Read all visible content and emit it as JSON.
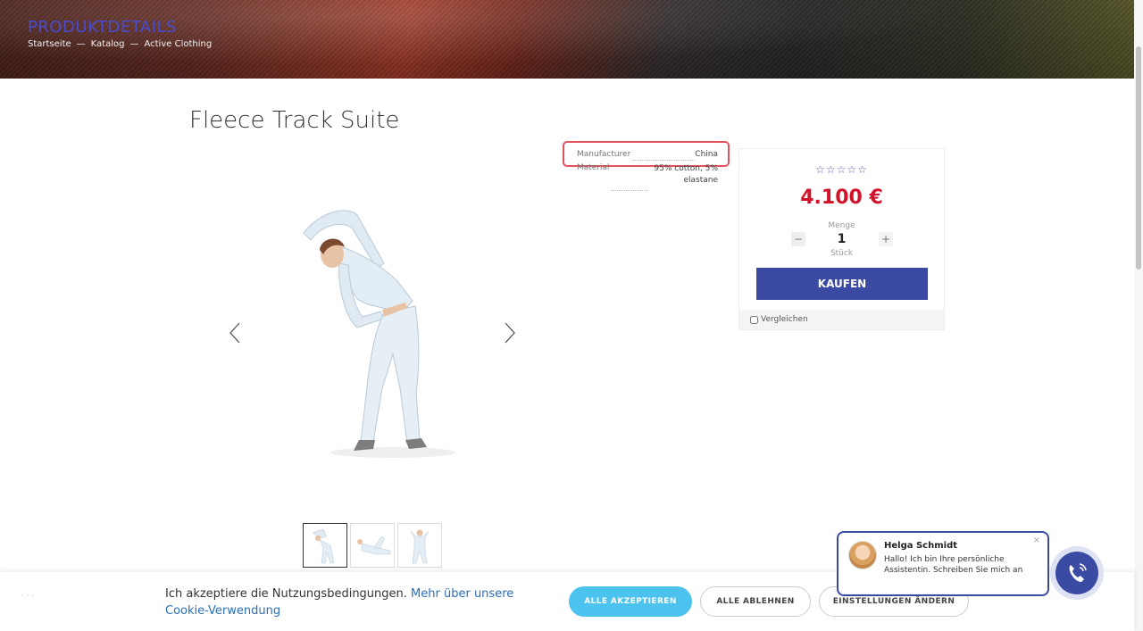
{
  "header": {
    "title": "PRODUKTDETAILS",
    "breadcrumb": [
      "Startseite",
      "Katalog",
      "Active Clothing"
    ],
    "separator": "—"
  },
  "product": {
    "title": "Fleece Track Suite",
    "attributes": [
      {
        "label": "Manufacturer",
        "value": "China"
      },
      {
        "label": "Material",
        "value": "95% cotton, 5% elastane"
      }
    ]
  },
  "buybox": {
    "rating_stars": "☆☆☆☆☆",
    "rating_value": 0,
    "rating_max": 5,
    "price": "4.100 €",
    "qty_label": "Menge",
    "qty_value": "1",
    "qty_unit": "Stück",
    "qty_minus": "−",
    "qty_plus": "+",
    "buy_label": "KAUFEN",
    "compare_label": "Vergleichen"
  },
  "chat": {
    "name": "Helga Schmidt",
    "message": "Hallo! Ich bin Ihre persönliche Assistentin. Schreiben Sie mich an",
    "close": "×"
  },
  "cookie": {
    "text": "Ich akzeptiere die Nutzungsbedingungen.",
    "link": "Mehr über unsere Cookie-Verwendung",
    "accept": "ALLE AKZEPTIEREN",
    "reject": "ALLE ABLEHNEN",
    "settings": "EINSTELLUNGEN ÄNDERN"
  },
  "colors": {
    "accent": "#3b4ba4",
    "price": "#d2112a",
    "cookie_accept": "#4cc3ee",
    "highlight": "#e2535c"
  }
}
